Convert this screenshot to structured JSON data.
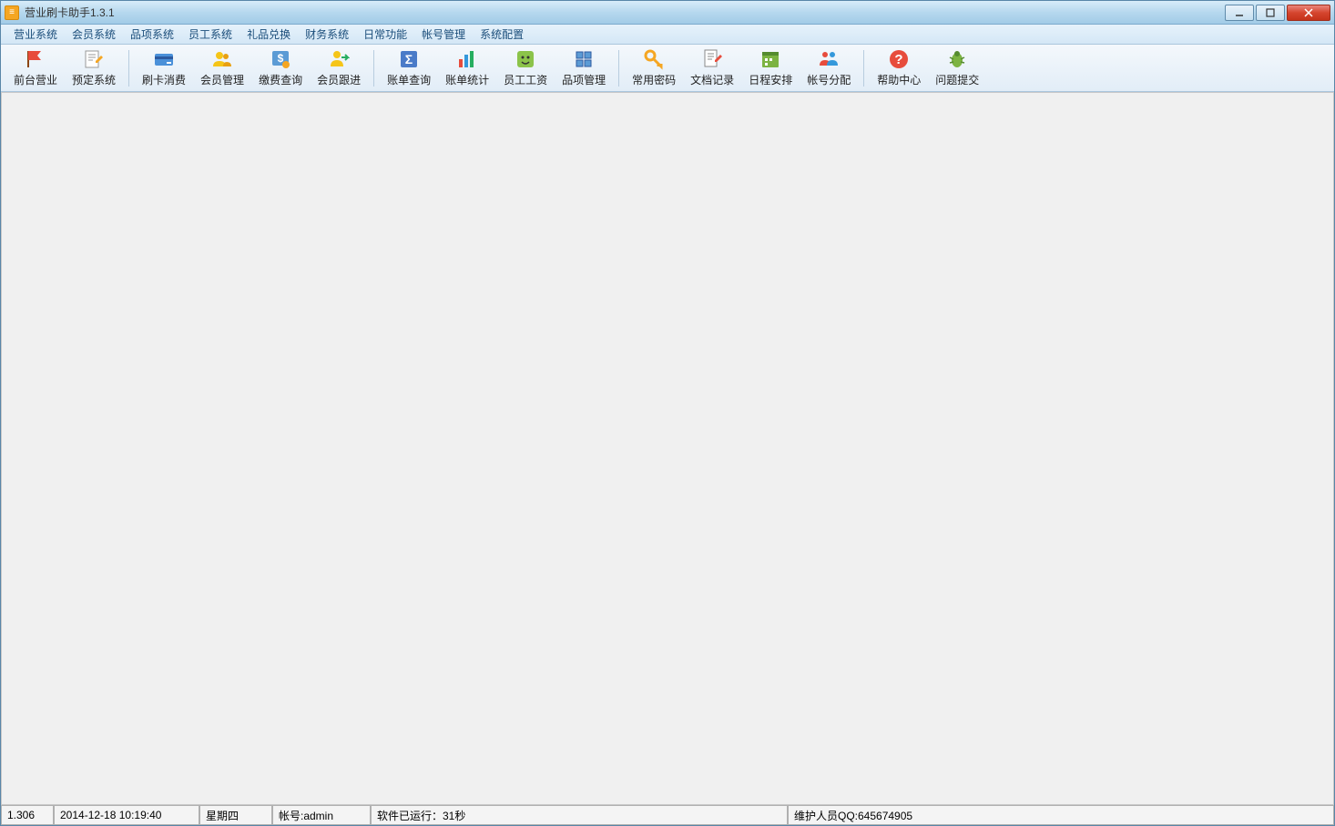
{
  "title": "营业刷卡助手1.3.1",
  "menu": {
    "items": [
      "营业系统",
      "会员系统",
      "品项系统",
      "员工系统",
      "礼品兑换",
      "财务系统",
      "日常功能",
      "帐号管理",
      "系统配置"
    ]
  },
  "toolbar": {
    "groups": [
      {
        "items": [
          {
            "name": "front-desk",
            "label": "前台营业",
            "icon": "flag-red"
          },
          {
            "name": "booking",
            "label": "预定系统",
            "icon": "note-edit"
          }
        ]
      },
      {
        "items": [
          {
            "name": "card-consume",
            "label": "刷卡消费",
            "icon": "card-blue"
          },
          {
            "name": "member-mgmt",
            "label": "会员管理",
            "icon": "users-yellow"
          },
          {
            "name": "fee-query",
            "label": "缴费查询",
            "icon": "money-blue"
          },
          {
            "name": "member-follow",
            "label": "会员跟进",
            "icon": "user-arrow"
          }
        ]
      },
      {
        "items": [
          {
            "name": "bill-query",
            "label": "账单查询",
            "icon": "sigma-blue"
          },
          {
            "name": "bill-stats",
            "label": "账单统计",
            "icon": "chart-bars"
          },
          {
            "name": "staff-salary",
            "label": "员工工资",
            "icon": "smiley-green"
          },
          {
            "name": "item-mgmt",
            "label": "品项管理",
            "icon": "boxes-blue"
          }
        ]
      },
      {
        "items": [
          {
            "name": "common-pwd",
            "label": "常用密码",
            "icon": "key-yellow"
          },
          {
            "name": "doc-record",
            "label": "文档记录",
            "icon": "doc-pencil"
          },
          {
            "name": "schedule",
            "label": "日程安排",
            "icon": "calendar-green"
          },
          {
            "name": "account-assign",
            "label": "帐号分配",
            "icon": "users-color"
          }
        ]
      },
      {
        "items": [
          {
            "name": "help-center",
            "label": "帮助中心",
            "icon": "help-red"
          },
          {
            "name": "issue-submit",
            "label": "问题提交",
            "icon": "bug-green"
          }
        ]
      }
    ]
  },
  "status": {
    "version": "1.306",
    "datetime": "2014-12-18 10:19:40",
    "weekday": "星期四",
    "account": "帐号:admin",
    "running": "软件已运行：31秒",
    "support": "维护人员QQ:645674905"
  }
}
